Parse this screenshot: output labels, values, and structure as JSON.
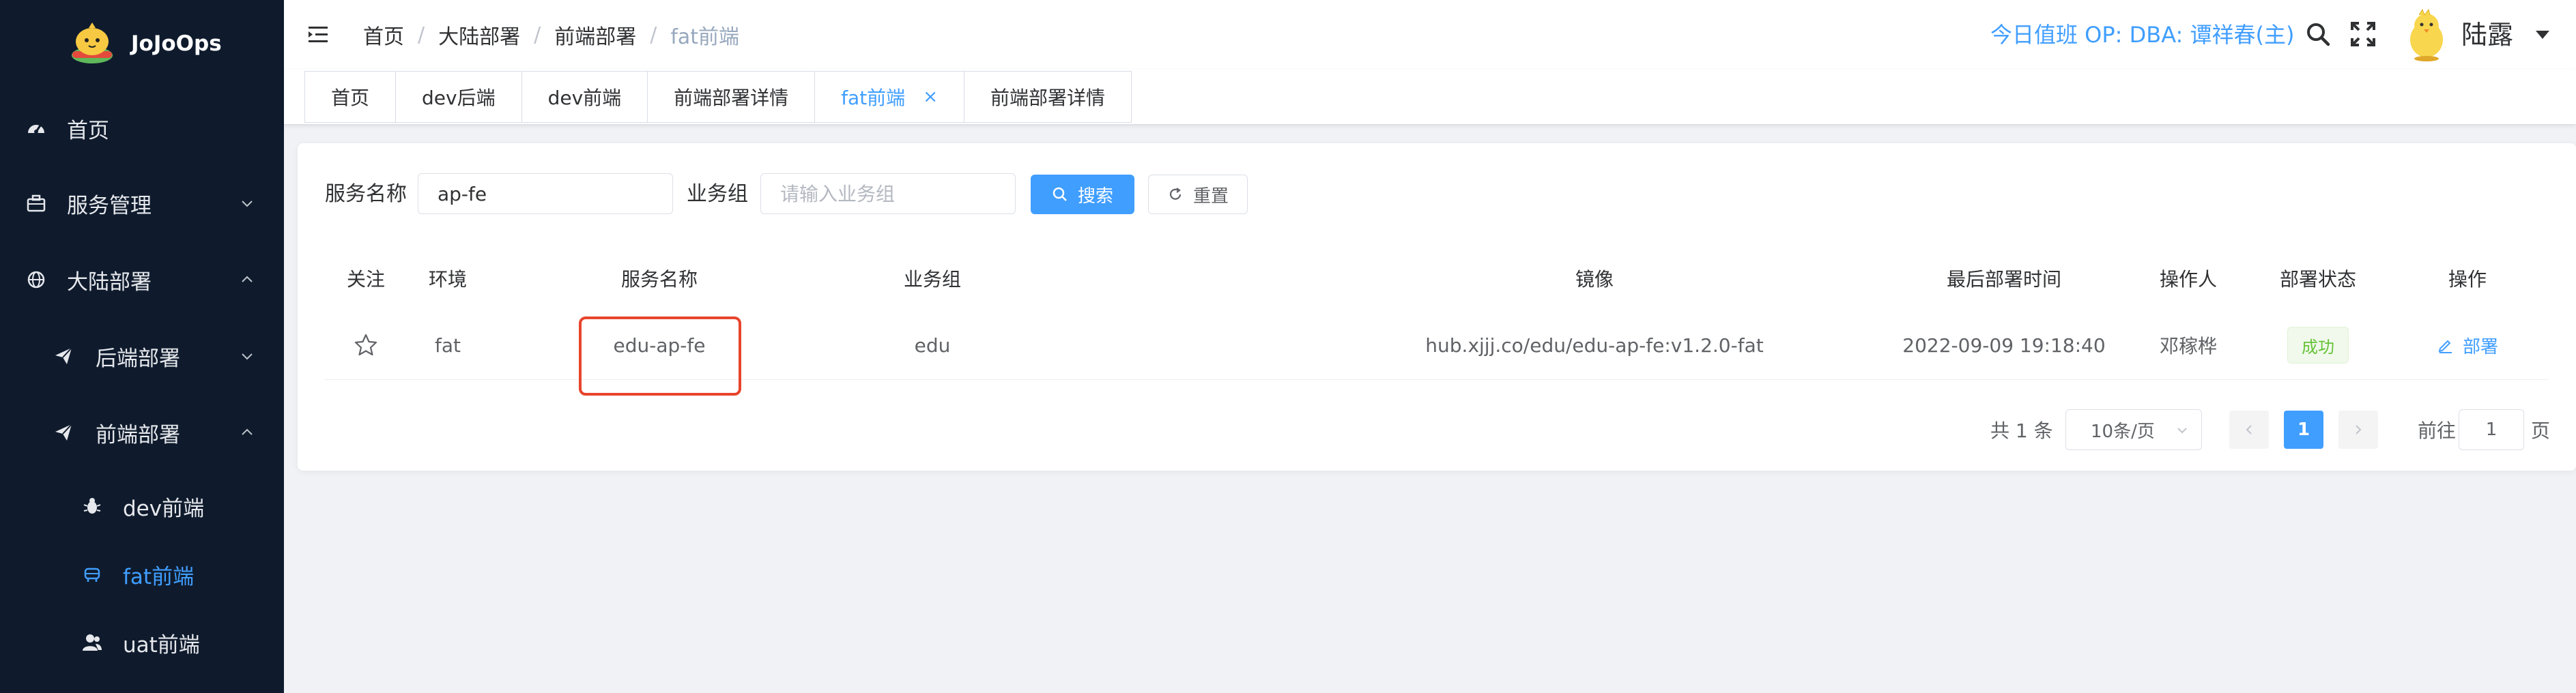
{
  "brand": {
    "name": "JoJoOps"
  },
  "sidebar": {
    "items": [
      {
        "label": "首页",
        "icon": "dashboard-icon"
      },
      {
        "label": "服务管理",
        "icon": "briefcase-icon"
      },
      {
        "label": "大陆部署",
        "icon": "globe-icon"
      },
      {
        "label": "后端部署",
        "icon": "paper-plane-icon"
      },
      {
        "label": "前端部署",
        "icon": "paper-plane-icon"
      },
      {
        "label": "dev前端",
        "icon": "bug-icon"
      },
      {
        "label": "fat前端",
        "icon": "robot-icon"
      },
      {
        "label": "uat前端",
        "icon": "user-icon"
      }
    ]
  },
  "header": {
    "breadcrumb": [
      "首页",
      "大陆部署",
      "前端部署",
      "fat前端"
    ],
    "duty": "今日值班 OP: DBA: 谭祥春(主)",
    "username": "陆露"
  },
  "tags": [
    {
      "label": "首页"
    },
    {
      "label": "dev后端"
    },
    {
      "label": "dev前端"
    },
    {
      "label": "前端部署详情"
    },
    {
      "label": "fat前端",
      "close": "×"
    },
    {
      "label": "前端部署详情"
    }
  ],
  "filter": {
    "service_label": "服务名称",
    "service_value": "ap-fe",
    "group_label": "业务组",
    "group_placeholder": "请输入业务组",
    "search_label": "搜索",
    "reset_label": "重置"
  },
  "table": {
    "headers": [
      "关注",
      "环境",
      "服务名称",
      "业务组",
      "镜像",
      "最后部署时间",
      "操作人",
      "部署状态",
      "操作"
    ],
    "rows": [
      {
        "env": "fat",
        "service": "edu-ap-fe",
        "group": "edu",
        "image": "hub.xjjj.co/edu/edu-ap-fe:v1.2.0-fat",
        "time": "2022-09-09 19:18:40",
        "operator": "邓稼桦",
        "status": "成功",
        "action": "部署"
      }
    ]
  },
  "pagination": {
    "total": "共 1 条",
    "page_size": "10条/页",
    "current": "1",
    "goto_prefix": "前往",
    "goto_value": "1",
    "goto_suffix": "页"
  },
  "colors": {
    "accent": "#409eff",
    "sidebar_bg": "#0f1b2d",
    "success": "#67c23a",
    "highlight": "#e8452c"
  }
}
